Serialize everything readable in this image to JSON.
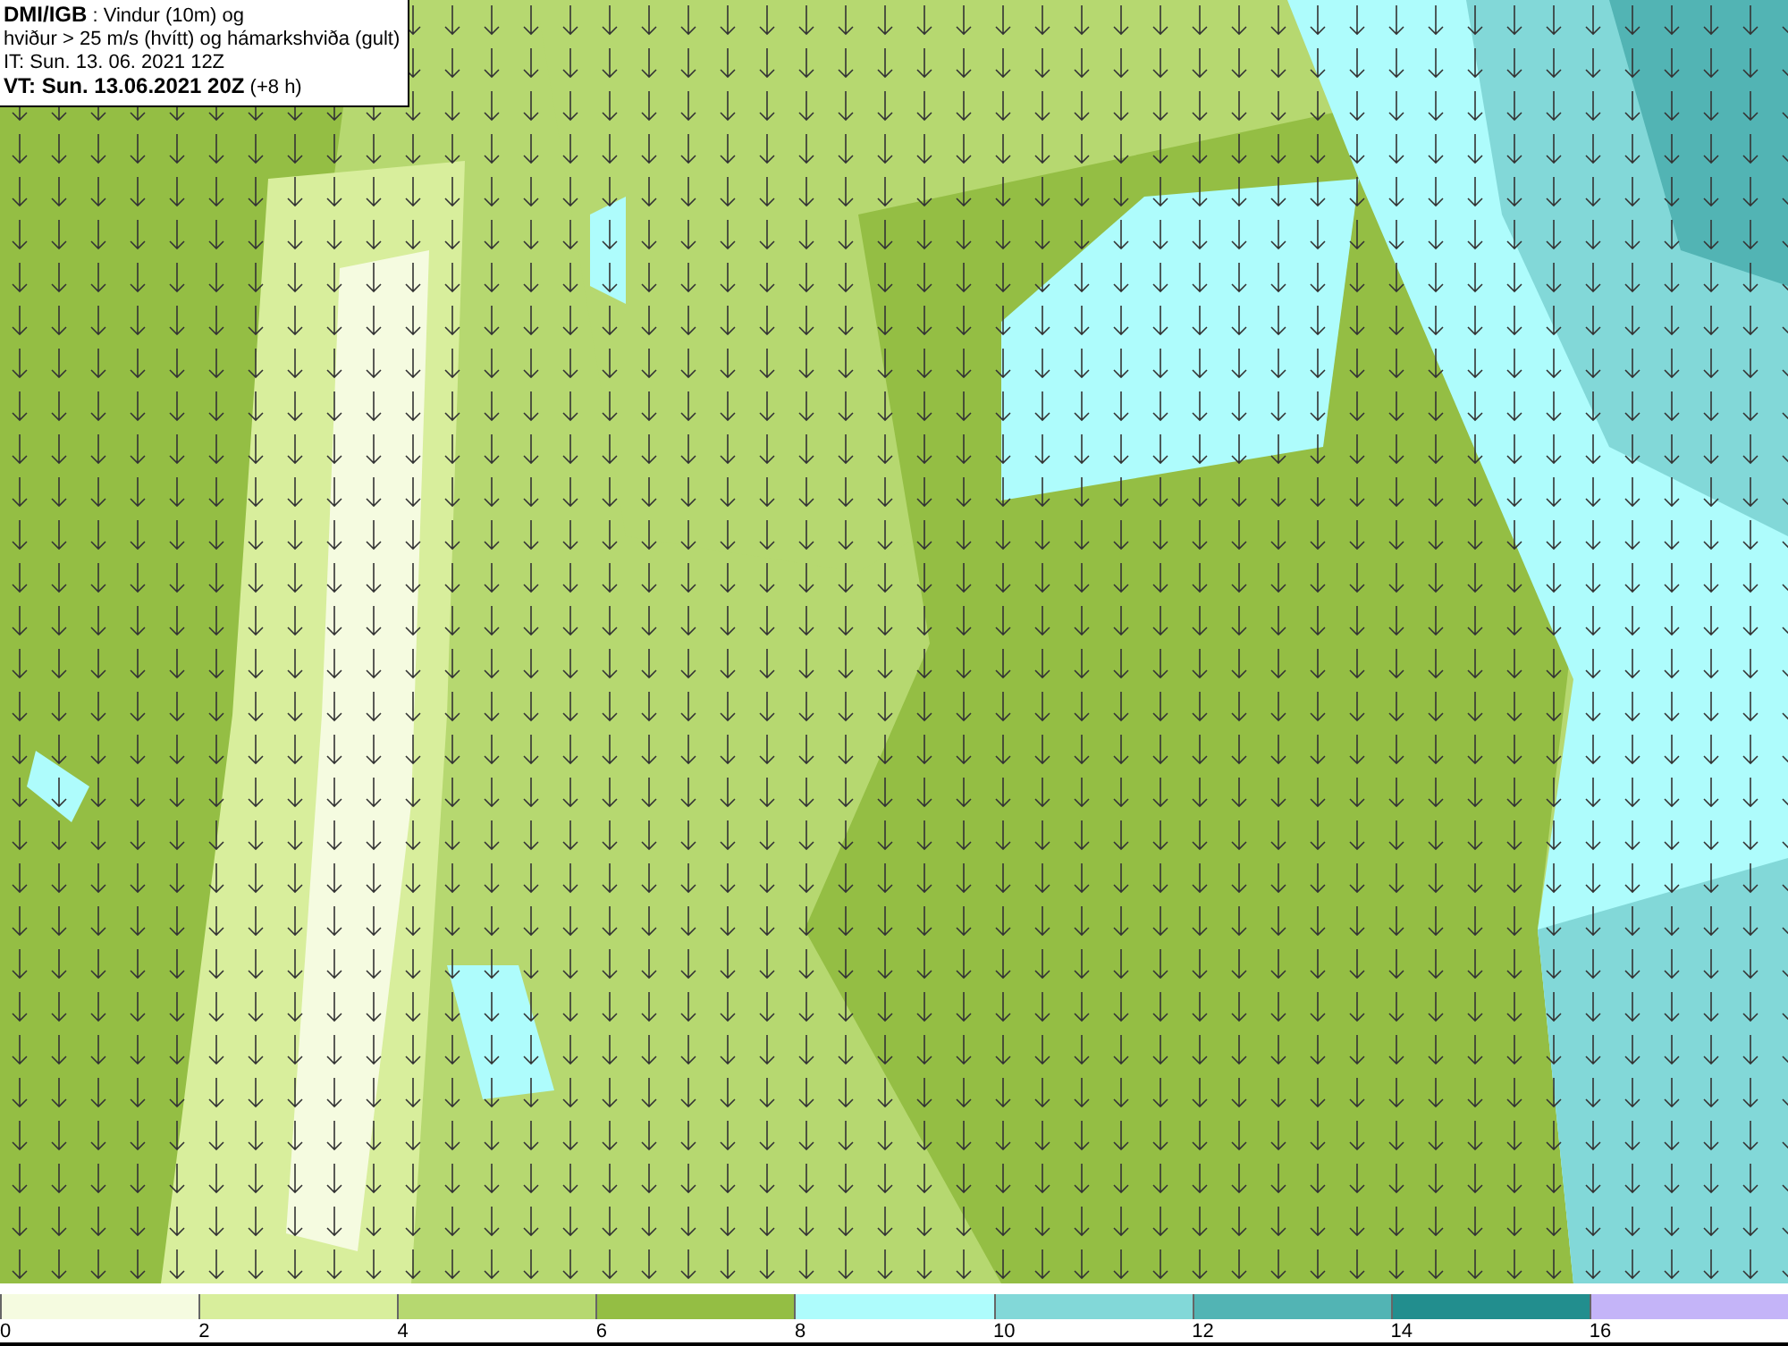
{
  "header": {
    "lines": [
      "**DMI/IGB** : Vindur (10m) og",
      "hviður > 25 m/s (hvítt) og hámarkshviða (gult)",
      "IT: Sun. 13. 06. 2021 12Z",
      "**VT: Sun. 13.06.2021 20Z** (+8 h)"
    ]
  },
  "legend": {
    "bins": [
      {
        "color": "#f5fbe0",
        "label": "0"
      },
      {
        "color": "#d8ee9c",
        "label": "2"
      },
      {
        "color": "#b6d870",
        "label": "4"
      },
      {
        "color": "#94be44",
        "label": "6"
      },
      {
        "color": "#aefcfc",
        "label": "8"
      },
      {
        "color": "#82d8d8",
        "label": "10"
      },
      {
        "color": "#52b4b4",
        "label": "12"
      },
      {
        "color": "#228e8e",
        "label": "14"
      },
      {
        "color": "#c4b4f8",
        "label": "16"
      }
    ]
  }
}
